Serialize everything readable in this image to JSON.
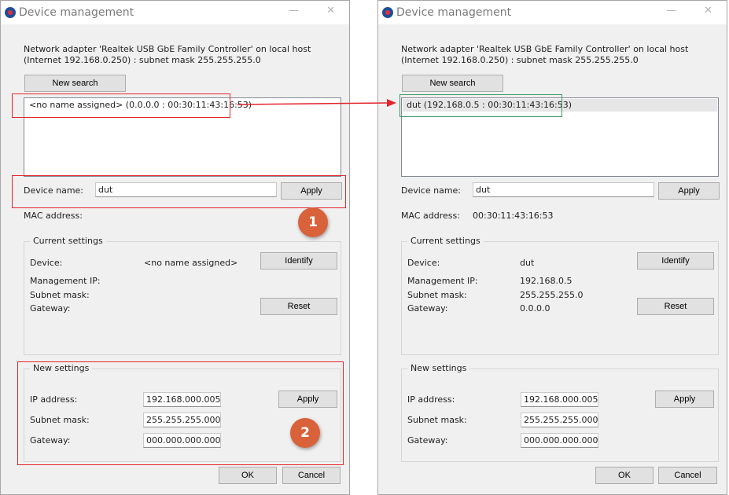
{
  "colors": {
    "highlight": "#e3262e",
    "highlight_ok": "#3c9a62",
    "badge": "#d9623a",
    "window_bg": "#f0f0f0"
  },
  "icons": [
    "app-logo-icon",
    "minimize-icon",
    "close-icon",
    "arrow-icon"
  ],
  "left": {
    "title": "Device management",
    "minimize": "—",
    "close": "✕",
    "adapter_info": "Network adapter 'Realtek USB GbE Family Controller' on local host (Internet 192.168.0.250) : subnet mask 255.255.255.0",
    "new_search": "New search",
    "device_list": [
      "<no name assigned> (0.0.0.0 : 00:30:11:43:16:53)"
    ],
    "device_name_label": "Device name:",
    "device_name_value": "dut",
    "apply": "Apply",
    "mac_label": "MAC address:",
    "mac_value": "",
    "current": {
      "title": "Current settings",
      "device_label": "Device:",
      "device_value": "<no name assigned>",
      "mgmt_ip_label": "Management IP:",
      "mgmt_ip_value": "",
      "subnet_label": "Subnet mask:",
      "subnet_value": "",
      "gateway_label": "Gateway:",
      "gateway_value": "",
      "identify": "Identify",
      "reset": "Reset"
    },
    "newset": {
      "title": "New settings",
      "ip_label": "IP address:",
      "ip_value": "192.168.000.005",
      "subnet_label": "Subnet mask:",
      "subnet_value": "255.255.255.000",
      "gateway_label": "Gateway:",
      "gateway_value": "000.000.000.000",
      "apply": "Apply"
    },
    "ok": "OK",
    "cancel": "Cancel",
    "badge1": "1",
    "badge2": "2"
  },
  "right": {
    "title": "Device management",
    "minimize": "—",
    "close": "✕",
    "adapter_info": "Network adapter 'Realtek USB GbE Family Controller' on local host (Internet 192.168.0.250) : subnet mask 255.255.255.0",
    "new_search": "New search",
    "device_list": [
      "dut (192.168.0.5 : 00:30:11:43:16:53)"
    ],
    "device_name_label": "Device name:",
    "device_name_value": "dut",
    "apply": "Apply",
    "mac_label": "MAC address:",
    "mac_value": "00:30:11:43:16:53",
    "current": {
      "title": "Current settings",
      "device_label": "Device:",
      "device_value": "dut",
      "mgmt_ip_label": "Management IP:",
      "mgmt_ip_value": "192.168.0.5",
      "subnet_label": "Subnet mask:",
      "subnet_value": "255.255.255.0",
      "gateway_label": "Gateway:",
      "gateway_value": "0.0.0.0",
      "identify": "Identify",
      "reset": "Reset"
    },
    "newset": {
      "title": "New settings",
      "ip_label": "IP address:",
      "ip_value": "192.168.000.005",
      "subnet_label": "Subnet mask:",
      "subnet_value": "255.255.255.000",
      "gateway_label": "Gateway:",
      "gateway_value": "000.000.000.000",
      "apply": "Apply"
    },
    "ok": "OK",
    "cancel": "Cancel"
  }
}
